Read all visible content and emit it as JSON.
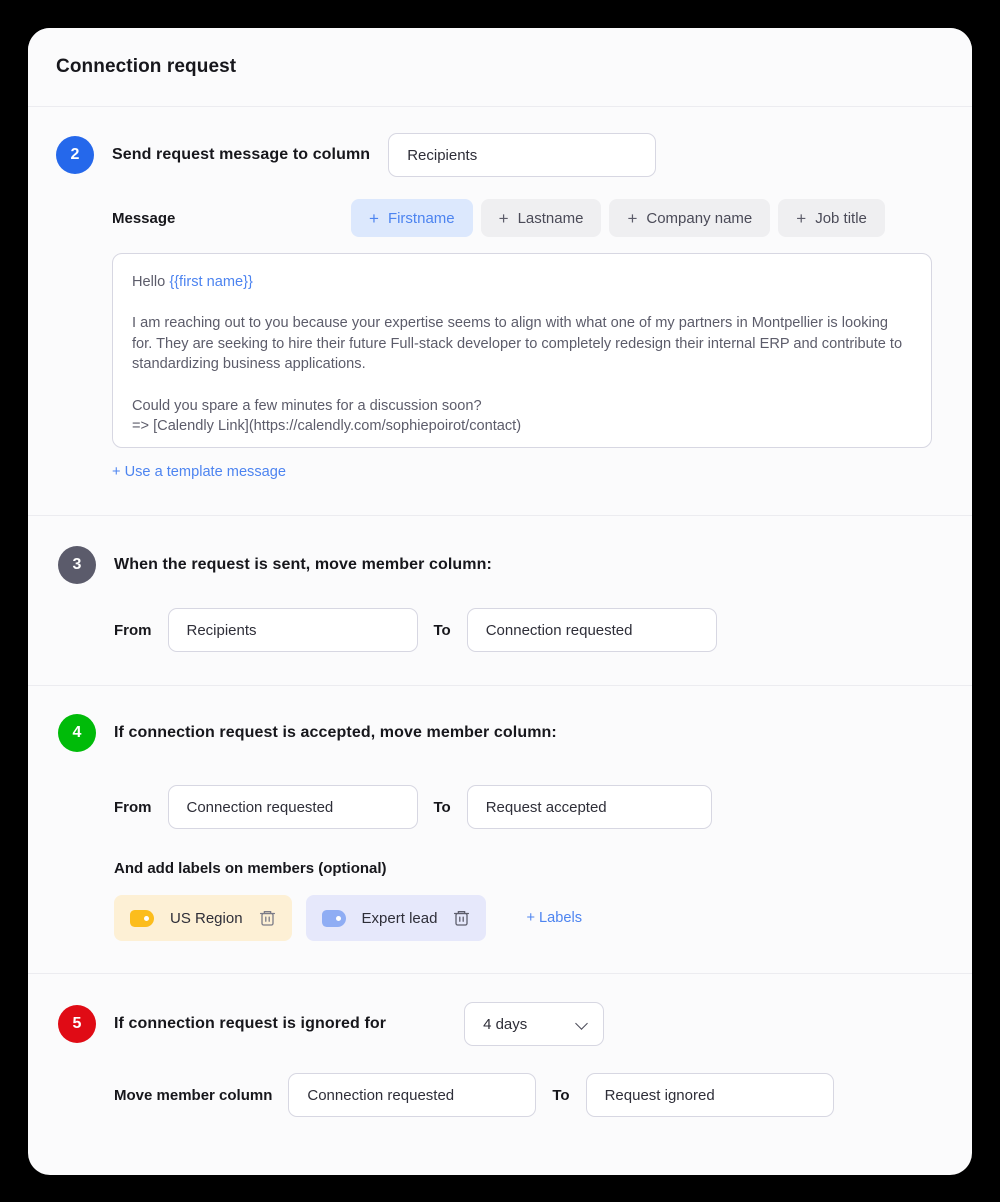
{
  "header": {
    "title": "Connection request"
  },
  "step2": {
    "number": "2",
    "title": "Send request message to column",
    "column_value": "Recipients",
    "message_label": "Message",
    "variables": [
      {
        "label": "Firstname",
        "plus": "+",
        "active": true
      },
      {
        "label": "Lastname",
        "plus": "+",
        "active": false
      },
      {
        "label": "Company name",
        "plus": "+",
        "active": false
      },
      {
        "label": "Job title",
        "plus": "+",
        "active": false
      }
    ],
    "message_greeting_prefix": "Hello ",
    "message_variable": "{{first name}}",
    "message_body": "\n\nI am reaching out to you because your expertise seems to align with what one of my partners in Montpellier is looking for. They are seeking to hire their future Full-stack developer to completely redesign their internal ERP and contribute to standardizing business applications.\n\nCould you spare a few minutes for a discussion soon?\n=> [Calendly Link](https://calendly.com/sophiepoirot/contact)",
    "template_link": "+ Use a template message"
  },
  "step3": {
    "number": "3",
    "title": "When the request is sent, move member column:",
    "from_label": "From",
    "from_value": "Recipients",
    "to_label": "To",
    "to_value": "Connection requested"
  },
  "step4": {
    "number": "4",
    "title": "If connection request is accepted, move member column:",
    "from_label": "From",
    "from_value": "Connection requested",
    "to_label": "To",
    "to_value": "Request accepted",
    "labels_title": "And add labels on members (optional)",
    "labels": [
      {
        "name": "US Region",
        "color": "#fcbd1c",
        "background": "#fdf0d5"
      },
      {
        "name": "Expert lead",
        "color": "#8fadf4",
        "background": "#e6e8fb"
      }
    ],
    "add_labels_link": "+ Labels"
  },
  "step5": {
    "number": "5",
    "title": "If connection request is ignored for",
    "delay_value": "4 days",
    "move_label": "Move member column",
    "from_value": "Connection requested",
    "to_label": "To",
    "to_value": "Request ignored"
  },
  "colors": {
    "step2_badge": "#2568eb",
    "step3_badge": "#5b5b6b",
    "step4_badge": "#00bb09",
    "step5_badge": "#e00b15",
    "accent_link": "#4d84f0"
  }
}
